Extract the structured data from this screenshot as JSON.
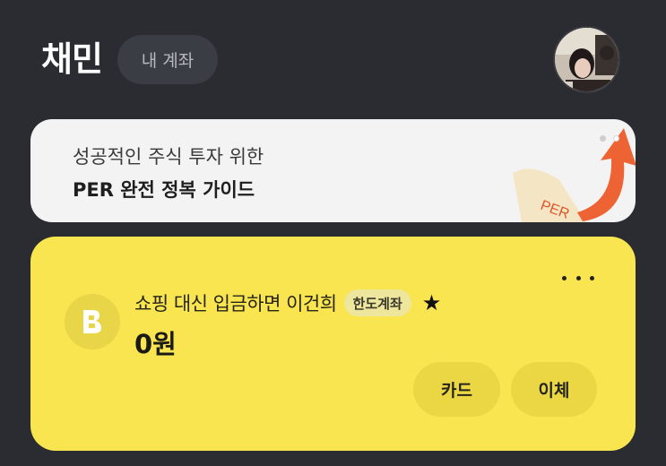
{
  "header": {
    "user_name": "채민",
    "my_account_label": "내 계좌",
    "avatar_icon": "profile-photo"
  },
  "banner": {
    "line1": "성공적인 주식 투자 위한",
    "line2": "PER 완전 정복 가이드",
    "art_text": "PER",
    "art_colors": {
      "arrow": "#ee6334",
      "paper": "#f4e6c4"
    }
  },
  "account": {
    "name": "쇼핑 대신 입금하면 이건희",
    "badge": "한도계좌",
    "balance": "0원",
    "bank_icon": "bank-b-icon",
    "card_label": "카드",
    "transfer_label": "이체",
    "card_color": "#f9e54f"
  },
  "colors": {
    "background": "#2b2c31",
    "banner_bg": "#f3f3f3"
  }
}
